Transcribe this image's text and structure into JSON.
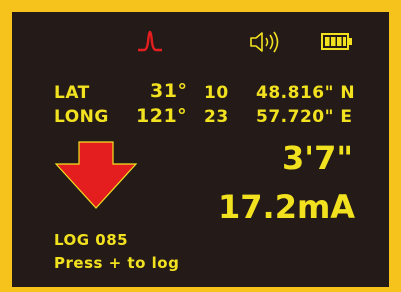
{
  "status_icons": {
    "signal": "signal-peak-icon",
    "speaker": "speaker-icon",
    "battery": "battery-full-icon",
    "signal_color": "#e41e1e",
    "accent_color": "#f2e11f"
  },
  "coordinates": {
    "lat_label": "LAT",
    "lat_deg": "31°",
    "lat_min": "10",
    "lat_sec": "48.816\" N",
    "long_label": "LONG",
    "long_deg": "121°",
    "long_min": "23",
    "long_sec": "57.720\" E"
  },
  "direction_arrow": "arrow-down-icon",
  "depth": "3'7\"",
  "current": "17.2mA",
  "log": {
    "number": "LOG 085",
    "hint": "Press + to log"
  }
}
